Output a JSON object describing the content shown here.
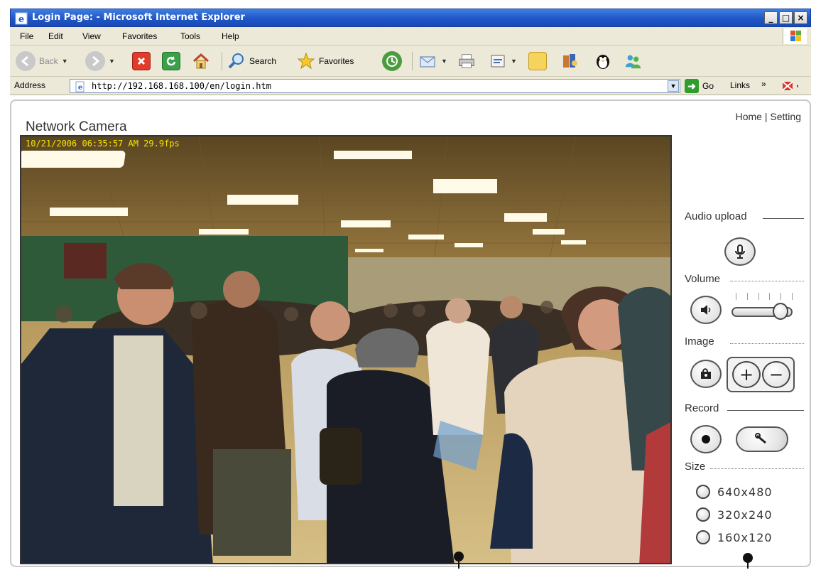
{
  "window": {
    "title": "Login Page: - Microsoft Internet Explorer",
    "buttons": {
      "minimize": "_",
      "maximize": "□",
      "close": "×"
    }
  },
  "menu": [
    {
      "label": "File"
    },
    {
      "label": "Edit"
    },
    {
      "label": "View"
    },
    {
      "label": "Favorites"
    },
    {
      "label": "Tools"
    },
    {
      "label": "Help"
    }
  ],
  "toolbar": {
    "back_label": "Back",
    "search_label": "Search",
    "favorites_label": "Favorites"
  },
  "address_bar": {
    "label": "Address",
    "url": "http://192.168.168.100/en/login.htm",
    "go_label": "Go",
    "links_label": "Links",
    "links_chevron": "»"
  },
  "page": {
    "title": "Network Camera",
    "top_links": {
      "home": "Home",
      "separator": "|",
      "setting": "Setting"
    },
    "video_overlay": "10/21/2006 06:35:57 AM  29.9fps"
  },
  "panel": {
    "audio_upload": "Audio upload",
    "volume": "Volume",
    "volume_level": 0.9,
    "image": "Image",
    "zoom_in": "+",
    "zoom_out": "−",
    "record": "Record",
    "size": "Size",
    "sizes": [
      "640x480",
      "320x240",
      "160x120"
    ]
  },
  "icons": {
    "microphone": "microphone-icon",
    "speaker": "speaker-icon",
    "snapshot": "snapshot-icon",
    "record": "record-icon",
    "tool": "wrench-icon"
  }
}
